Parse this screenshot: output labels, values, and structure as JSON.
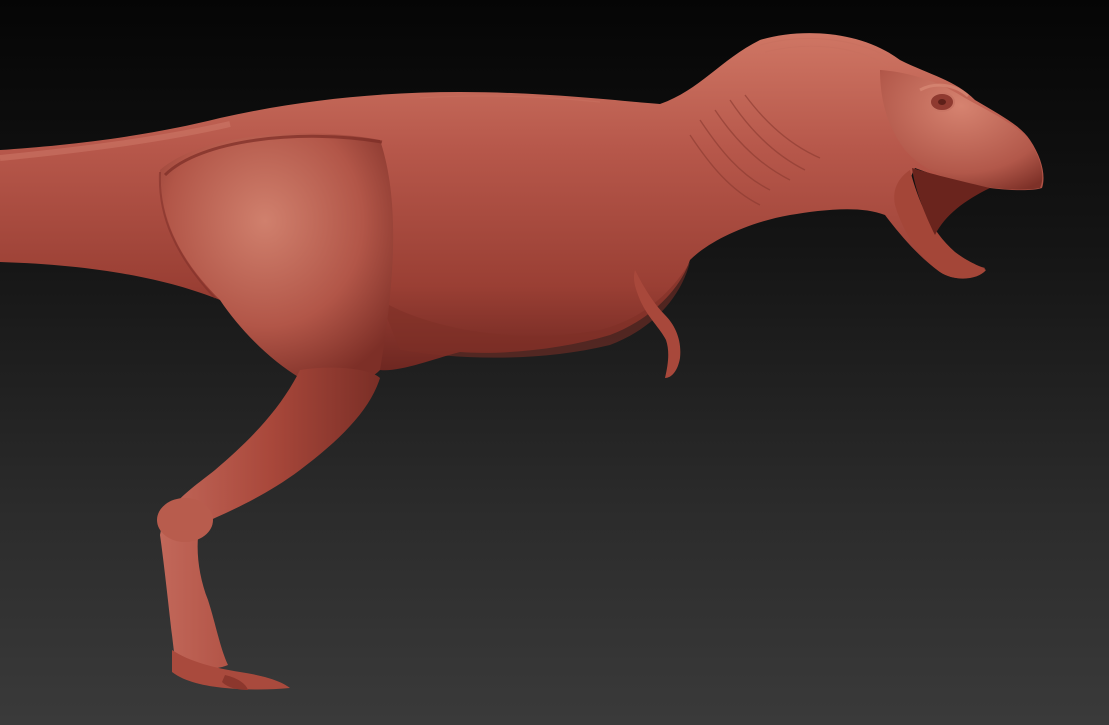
{
  "scene": {
    "subject": "tyrannosaurus-sculpt",
    "colors": {
      "background_top": "#050505",
      "background_bottom": "#3a3a3a",
      "clay_base": "#a9483b",
      "clay_light": "#cf7664",
      "clay_dark": "#6e2721"
    }
  }
}
